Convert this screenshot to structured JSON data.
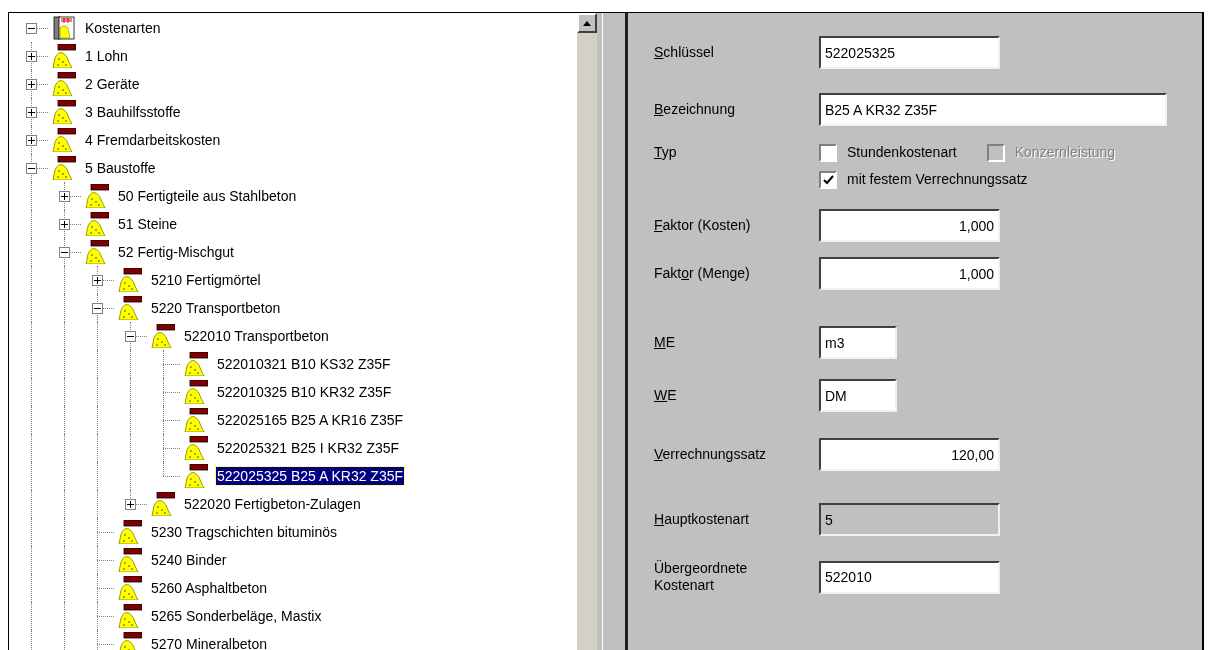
{
  "tree": {
    "root": {
      "label": "Kostenarten",
      "expanded": true,
      "selected": false,
      "children": [
        {
          "label": "1 Lohn",
          "expanded": false,
          "selected": false
        },
        {
          "label": "2 Geräte",
          "expanded": false,
          "selected": false
        },
        {
          "label": "3 Bauhilfsstoffe",
          "expanded": false,
          "selected": false
        },
        {
          "label": "4 Fremdarbeitskosten",
          "expanded": false,
          "selected": false
        },
        {
          "label": "5 Baustoffe",
          "expanded": true,
          "selected": false,
          "children": [
            {
              "label": "50 Fertigteile aus Stahlbeton",
              "expanded": false,
              "selected": false
            },
            {
              "label": "51 Steine",
              "expanded": false,
              "selected": false
            },
            {
              "label": "52 Fertig-Mischgut",
              "expanded": true,
              "selected": false,
              "children": [
                {
                  "label": "5210 Fertigmörtel",
                  "expanded": false,
                  "selected": false
                },
                {
                  "label": "5220 Transportbeton",
                  "expanded": true,
                  "selected": false,
                  "children": [
                    {
                      "label": "522010 Transportbeton",
                      "expanded": true,
                      "selected": false,
                      "children": [
                        {
                          "label": "522010321 B10 KS32 Z35F",
                          "selected": false
                        },
                        {
                          "label": "522010325 B10 KR32 Z35F",
                          "selected": false
                        },
                        {
                          "label": "522025165 B25 A KR16 Z35F",
                          "selected": false
                        },
                        {
                          "label": "522025321 B25 I KR32 Z35F",
                          "selected": false
                        },
                        {
                          "label": "522025325 B25 A KR32 Z35F",
                          "selected": true
                        }
                      ]
                    },
                    {
                      "label": "522020 Fertigbeton-Zulagen",
                      "expanded": false,
                      "selected": false
                    }
                  ]
                },
                {
                  "label": "5230 Tragschichten bituminös",
                  "selected": false
                },
                {
                  "label": "5240 Binder",
                  "selected": false
                },
                {
                  "label": "5260 Asphaltbeton",
                  "selected": false
                },
                {
                  "label": "5265 Sonderbeläge, Mastix",
                  "selected": false
                },
                {
                  "label": "5270 Mineralbeton",
                  "selected": false
                }
              ]
            }
          ]
        }
      ]
    }
  },
  "form": {
    "rows": [
      {
        "kind": "text",
        "label": {
          "key": "S",
          "post": "chlüssel"
        },
        "value": "522025325",
        "disabled": false
      },
      {
        "kind": "wide_text",
        "label": {
          "key": "B",
          "post": "ezeichnung"
        },
        "value": "B25 A KR32 Z35F",
        "disabled": false
      },
      {
        "kind": "checkboxes",
        "label": {
          "key": "T",
          "post": "yp"
        },
        "boxes": [
          {
            "label": "Stundenkostenart",
            "checked": false,
            "disabled": false
          },
          {
            "label": "Konzernleistung",
            "checked": false,
            "disabled": true
          }
        ]
      },
      {
        "kind": "checkboxes",
        "boxes": [
          {
            "label": "mit festem Verrechnungssatz",
            "checked": true,
            "disabled": false
          }
        ]
      },
      {
        "kind": "number",
        "label": {
          "key": "F",
          "post": "aktor (Kosten)"
        },
        "value": "1,000",
        "disabled": false
      },
      {
        "kind": "number",
        "label": {
          "pre": "Fakt",
          "key": "o",
          "post": "r (Menge)"
        },
        "value": "1,000",
        "disabled": false
      },
      {
        "kind": "unit",
        "label": {
          "key": "M",
          "post": "E"
        },
        "value": "m3",
        "disabled": false
      },
      {
        "kind": "unit",
        "label": {
          "key": "W",
          "post": "E"
        },
        "value": "DM",
        "disabled": false
      },
      {
        "kind": "number",
        "label": {
          "key": "V",
          "post": "errechnungssatz"
        },
        "value": "120,00",
        "disabled": false
      },
      {
        "kind": "text",
        "label": {
          "key": "H",
          "post": "auptkostenart"
        },
        "value": "5",
        "disabled": true
      },
      {
        "kind": "text",
        "label": {
          "pre": "Übergeordnete Kostenart"
        },
        "value": "522010",
        "disabled": false
      }
    ]
  }
}
